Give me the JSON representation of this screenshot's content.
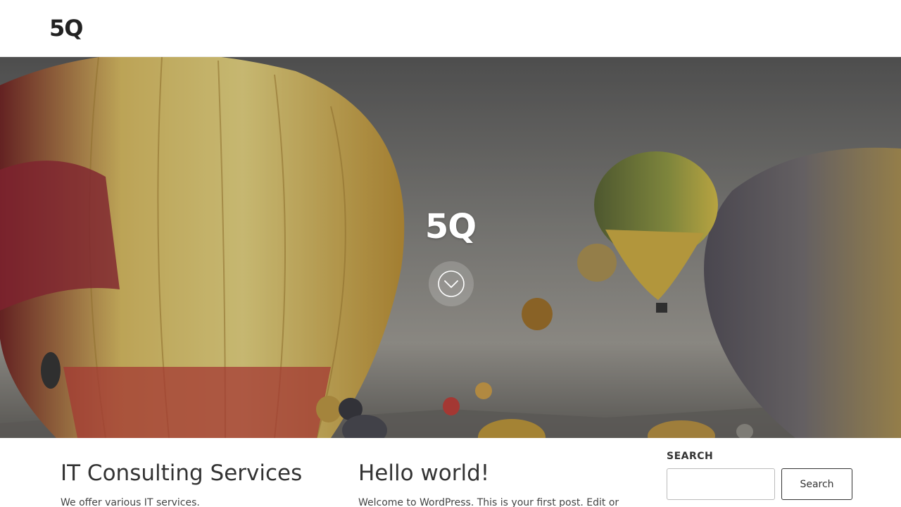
{
  "header": {
    "site_title": "5Q"
  },
  "hero": {
    "title": "5Q",
    "scroll_icon": "chevron-down-circle-icon"
  },
  "posts": [
    {
      "title": "IT Consulting Services",
      "excerpt": "We offer various IT services."
    },
    {
      "title": "Hello world!",
      "excerpt": "Welcome to WordPress. This is your first post. Edit or"
    }
  ],
  "sidebar": {
    "search": {
      "title": "SEARCH",
      "placeholder": "",
      "button_label": "Search"
    }
  },
  "colors": {
    "text": "#333333",
    "hero_title": "#ffffff",
    "header_bg": "#ffffff"
  }
}
